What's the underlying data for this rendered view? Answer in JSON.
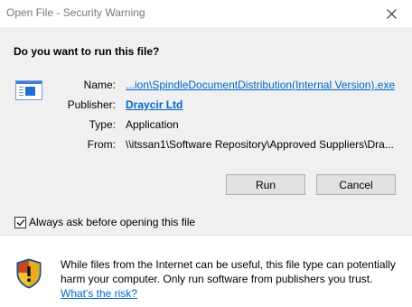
{
  "window": {
    "title": "Open File - Security Warning",
    "close_icon": "close-icon"
  },
  "dialog": {
    "question": "Do you want to run this file?",
    "file_icon": "executable-file-icon",
    "fields": {
      "name_label": "Name:",
      "name_value": "...ion\\SpindleDocumentDistribution(Internal Version).exe",
      "publisher_label": "Publisher:",
      "publisher_value": "Draycir Ltd",
      "type_label": "Type:",
      "type_value": "Application",
      "from_label": "From:",
      "from_value": "\\\\itssan1\\Software Repository\\Approved Suppliers\\Dra..."
    },
    "buttons": {
      "run": "Run",
      "cancel": "Cancel"
    },
    "checkbox": {
      "label": "Always ask before opening this file",
      "checked": true
    }
  },
  "warning": {
    "icon": "security-shield-icon",
    "text": "While files from the Internet can be useful, this file type can potentially harm your computer. Only run software from publishers you trust.",
    "link": "What's the risk?"
  },
  "colors": {
    "link": "#0066cc",
    "dialog_background": "#f0f0f0",
    "button_face": "#e1e1e1",
    "button_border": "#adadad",
    "title_text": "#777777"
  }
}
